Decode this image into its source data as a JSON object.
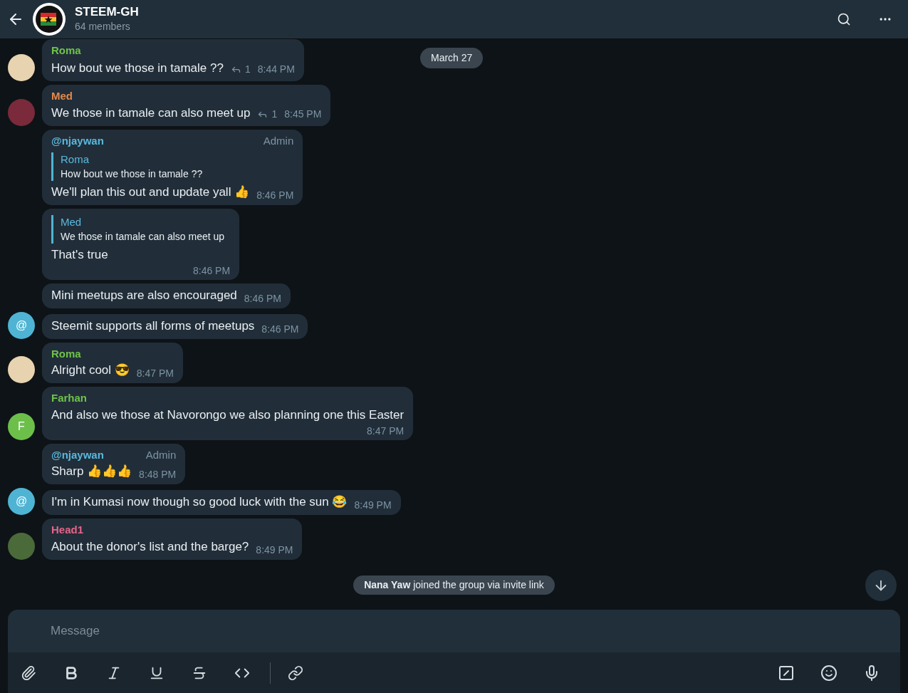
{
  "header": {
    "title": "STEEM-GH",
    "subtitle": "64 members"
  },
  "date_pill": "March 27",
  "messages": [
    {
      "author": "Roma",
      "color": "#6fc24a",
      "avatar": {
        "kind": "photo",
        "color": "#e8d3b0"
      },
      "text": "How bout we those in tamale ??",
      "replies": "1",
      "time": "8:44 PM"
    },
    {
      "author": "Med",
      "color": "#e58a4a",
      "avatar": {
        "kind": "photo",
        "color": "#7a2a3a"
      },
      "text": "We those in tamale can also meet up",
      "replies": "1",
      "time": "8:45 PM"
    },
    {
      "author": "@njaywan",
      "color": "#5ab8dc",
      "badge": "Admin",
      "quote": {
        "author": "Roma",
        "text": "How bout we those in tamale ??"
      },
      "text": "We'll plan this out and update yall 👍",
      "time": "8:46 PM"
    },
    {
      "quote": {
        "author": "Med",
        "text": "We those in tamale can also meet up"
      },
      "text": "That's true",
      "time": "8:46 PM",
      "time_below": true
    },
    {
      "text": "Mini meetups are also encouraged",
      "time": "8:46 PM"
    },
    {
      "avatar": {
        "kind": "letter",
        "letter": "@",
        "color": "#4fb4d4"
      },
      "text": "Steemit supports all forms of meetups",
      "time": "8:46 PM"
    },
    {
      "author": "Roma",
      "color": "#6fc24a",
      "avatar": {
        "kind": "photo",
        "color": "#e8d3b0"
      },
      "text": "Alright cool 😎",
      "time": "8:47 PM"
    },
    {
      "author": "Farhan",
      "color": "#6fc24a",
      "avatar": {
        "kind": "letter",
        "letter": "F",
        "color": "#6cc04a"
      },
      "text": "And also we those at Navorongo we also planning one this Easter",
      "time": "8:47 PM",
      "time_below": true
    },
    {
      "author": "@njaywan",
      "color": "#5ab8dc",
      "badge": "Admin",
      "text": "Sharp 👍👍👍",
      "time": "8:48 PM"
    },
    {
      "avatar": {
        "kind": "letter",
        "letter": "@",
        "color": "#4fb4d4"
      },
      "text": "I'm in Kumasi now though so good luck with the sun 😂",
      "time": "8:49 PM"
    },
    {
      "author": "Head1",
      "color": "#e5648a",
      "avatar": {
        "kind": "photo",
        "color": "#4a6a3a"
      },
      "text": "About the donor's list and the barge?",
      "time": "8:49 PM"
    }
  ],
  "service_message": "**Nana Yaw** joined the group via invite link",
  "composer": {
    "placeholder": "Message"
  }
}
